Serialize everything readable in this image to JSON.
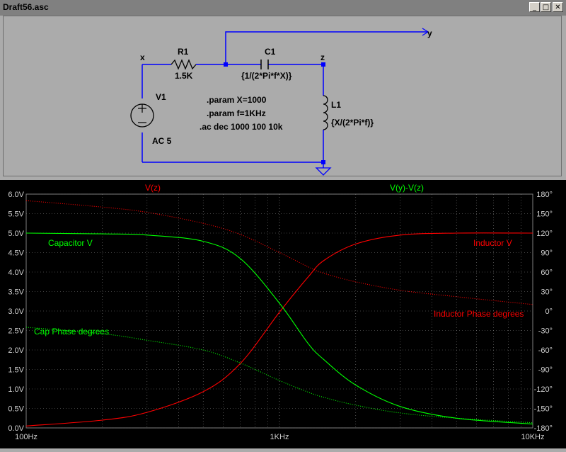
{
  "window": {
    "title": "Draft56.asc",
    "minimize_glyph": "_",
    "restore_glyph": "□",
    "close_glyph": "✕"
  },
  "schematic": {
    "nets": {
      "x": "x",
      "y": "y",
      "z": "z"
    },
    "r1": {
      "name": "R1",
      "value": "1.5K"
    },
    "c1": {
      "name": "C1",
      "value": "{1/(2*Pi*f*X)}"
    },
    "l1": {
      "name": "L1",
      "value": "{X/(2*Pi*f)}"
    },
    "v1": {
      "name": "V1",
      "value": "AC 5"
    },
    "directives": [
      ".param X=1000",
      ".param f=1KHz",
      ".ac dec 1000 100 10k"
    ]
  },
  "plot": {
    "trace_headers": [
      {
        "label": "V(z)",
        "color": "#ff0000"
      },
      {
        "label": "V(y)-V(z)",
        "color": "#00ff00"
      }
    ],
    "left_ticks": [
      "6.0V",
      "5.5V",
      "5.0V",
      "4.5V",
      "4.0V",
      "3.5V",
      "3.0V",
      "2.5V",
      "2.0V",
      "1.5V",
      "1.0V",
      "0.5V",
      "0.0V"
    ],
    "right_ticks": [
      "180°",
      "150°",
      "120°",
      "90°",
      "60°",
      "30°",
      "0°",
      "-30°",
      "-60°",
      "-90°",
      "-120°",
      "-150°",
      "-180°"
    ],
    "x_ticks": [
      "100Hz",
      "1KHz",
      "10KHz"
    ],
    "annotations": {
      "capacitor_v": "Capacitor V",
      "cap_phase": "Cap Phase degrees",
      "inductor_v": "Inductor V",
      "inductor_phase": "Inductor Phase degrees"
    },
    "colors": {
      "red": "#ff0000",
      "green": "#00ff00",
      "grid": "#7f7f7f",
      "axis_text": "#d0d0d0"
    }
  },
  "chart_data": {
    "type": "line",
    "x_scale": "log",
    "xlim": [
      100,
      10000
    ],
    "ylim_left": [
      0,
      6
    ],
    "ylim_right": [
      -180,
      180
    ],
    "x": [
      100,
      200,
      300,
      500,
      700,
      1000,
      1300,
      1500,
      2000,
      3000,
      5000,
      10000
    ],
    "series": [
      {
        "name": "V(z)",
        "axis": "left",
        "style": "solid",
        "color": "#ff0000",
        "values": [
          0.05,
          0.2,
          0.4,
          0.93,
          1.65,
          2.97,
          3.88,
          4.3,
          4.72,
          4.95,
          5.0,
          5.0
        ]
      },
      {
        "axis": "right",
        "style": "dotted",
        "color": "#ff0000",
        "values": [
          170,
          160,
          152,
          135,
          118,
          90,
          68,
          58,
          45,
          32,
          22,
          10
        ]
      },
      {
        "name": "V(y)-V(z)",
        "axis": "left",
        "style": "solid",
        "color": "#00ff00",
        "values": [
          5.0,
          4.98,
          4.95,
          4.79,
          4.35,
          3.2,
          2.16,
          1.75,
          1.1,
          0.55,
          0.25,
          0.1
        ]
      },
      {
        "axis": "right",
        "style": "dotted",
        "color": "#00ff00",
        "values": [
          -25,
          -35,
          -45,
          -60,
          -80,
          -107,
          -125,
          -133,
          -145,
          -157,
          -165,
          -172
        ]
      }
    ]
  }
}
